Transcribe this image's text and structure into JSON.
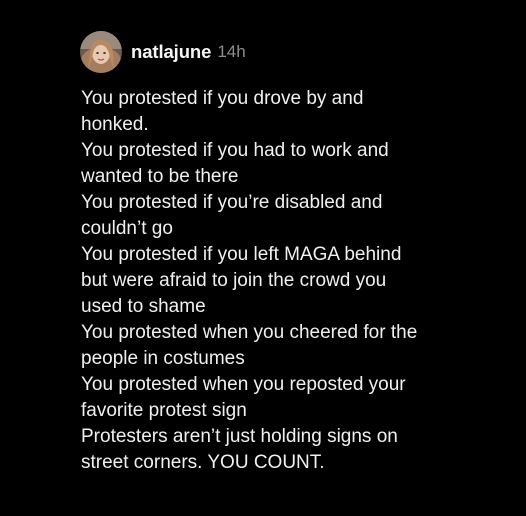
{
  "post": {
    "author": "natlajune",
    "timestamp": "14h",
    "lines": [
      "You protested if you drove by and\nhonked.",
      "You protested if you had to work and\nwanted to be there",
      "You protested if you’re disabled and\ncouldn’t go",
      "You protested if you left MAGA behind\nbut were afraid to join the crowd you\nused to shame",
      "You protested when you cheered for the\npeople in costumes",
      "You protested when you reposted your\nfavorite protest sign",
      "Protesters aren’t just holding signs on\nstreet corners. YOU COUNT."
    ]
  },
  "colors": {
    "background": "#000000",
    "text": "#f0f0f0",
    "timestamp": "#8e8e8e"
  }
}
